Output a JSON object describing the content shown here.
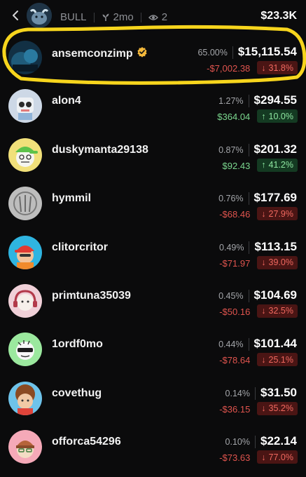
{
  "header": {
    "token_name": "BULL",
    "age": "2mo",
    "watchers": "2",
    "total_value": "$23.3K",
    "colors": {
      "muted": "#8d8f94"
    }
  },
  "holders": [
    {
      "name": "ansemconzimp",
      "verified": true,
      "share": "65.00%",
      "value": "$15,115.54",
      "pnl": "-$7,002.38",
      "change": "31.8%",
      "direction": "down",
      "avatar": "dark-photo"
    },
    {
      "name": "alon4",
      "verified": false,
      "share": "1.27%",
      "value": "$294.55",
      "pnl": "$364.04",
      "change": "10.0%",
      "direction": "up",
      "avatar": "robot"
    },
    {
      "name": "duskymanta29138",
      "verified": false,
      "share": "0.87%",
      "value": "$201.32",
      "pnl": "$92.43",
      "change": "41.2%",
      "direction": "up",
      "avatar": "green-cap"
    },
    {
      "name": "hymmil",
      "verified": false,
      "share": "0.76%",
      "value": "$177.69",
      "pnl": "-$68.46",
      "change": "27.9%",
      "direction": "down",
      "avatar": "gray-sketch"
    },
    {
      "name": "clitorcritor",
      "verified": false,
      "share": "0.49%",
      "value": "$113.15",
      "pnl": "-$71.97",
      "change": "39.0%",
      "direction": "down",
      "avatar": "red-cap"
    },
    {
      "name": "primtuna35039",
      "verified": false,
      "share": "0.45%",
      "value": "$104.69",
      "pnl": "-$50.16",
      "change": "32.5%",
      "direction": "down",
      "avatar": "headphones"
    },
    {
      "name": "1ordf0mo",
      "verified": false,
      "share": "0.44%",
      "value": "$101.44",
      "pnl": "-$78.64",
      "change": "25.1%",
      "direction": "down",
      "avatar": "bald-shades"
    },
    {
      "name": "covethug",
      "verified": false,
      "share": "0.14%",
      "value": "$31.50",
      "pnl": "-$36.15",
      "change": "35.2%",
      "direction": "down",
      "avatar": "afro"
    },
    {
      "name": "offorca54296",
      "verified": false,
      "share": "0.10%",
      "value": "$22.14",
      "pnl": "-$73.63",
      "change": "77.0%",
      "direction": "down",
      "avatar": "beanie"
    }
  ],
  "colors": {
    "background": "#0b0b0c",
    "negative": "#e0544e",
    "positive": "#7bd88f",
    "negative_badge_bg": "#4a1514",
    "positive_badge_bg": "#143a22",
    "highlight": "#f7d51d",
    "verified": "#f5b93b"
  }
}
